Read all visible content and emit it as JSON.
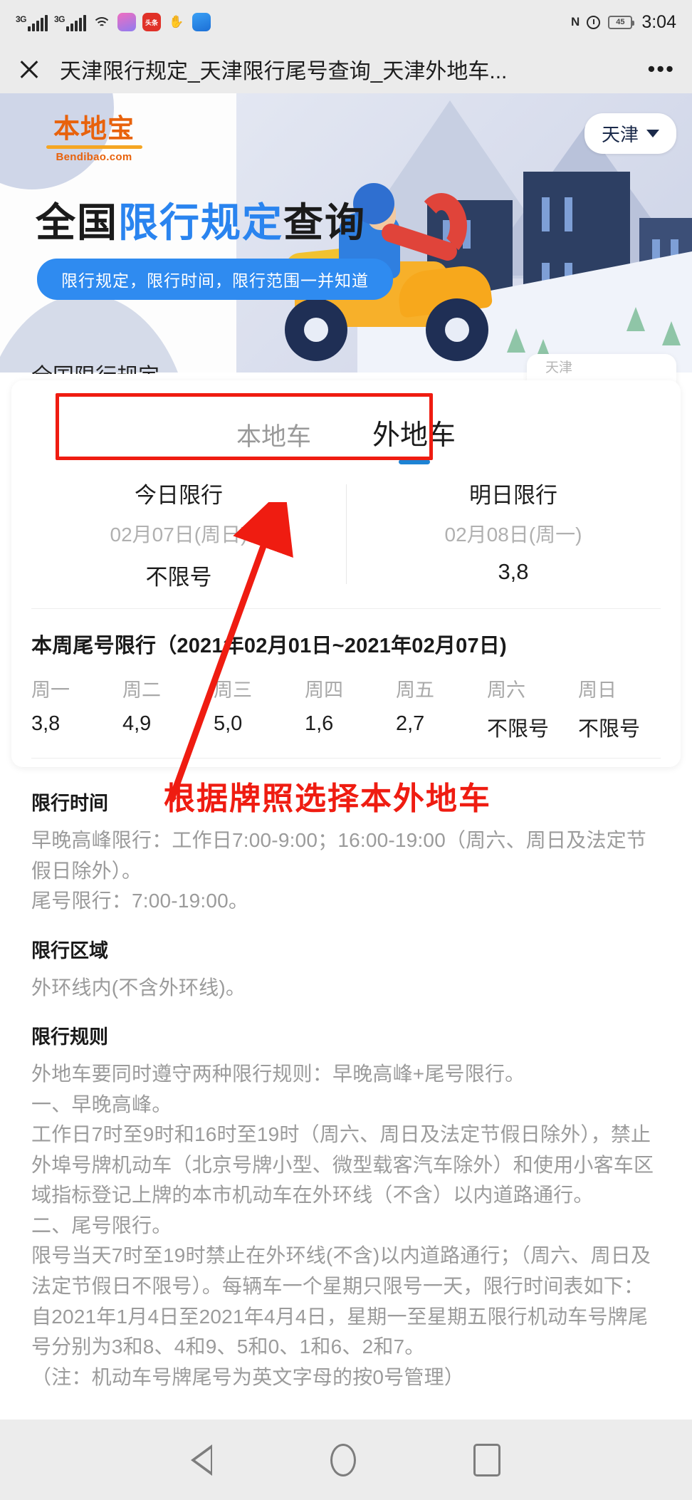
{
  "status_bar": {
    "signal_1": "3G",
    "signal_2": "3G",
    "icons": [
      "signal-icon",
      "signal-icon",
      "wifi-icon",
      "app-icon-pink",
      "app-icon-toutiao",
      "app-icon-hand",
      "app-icon-browser",
      "nfc-icon",
      "alarm-icon"
    ],
    "toutiao_label": "头条",
    "nfc_glyph": "N",
    "battery_level": "45",
    "time": "3:04"
  },
  "title_bar": {
    "title": "天津限行规定_天津限行尾号查询_天津外地车...",
    "close_label": "×",
    "more_label": "•••"
  },
  "banner": {
    "logo_cn": "本地宝",
    "logo_en": "Bendibao.com",
    "title_part1": "全国",
    "title_highlight": "限行规定",
    "title_part2": "查询",
    "subtitle_pill": "限行规定，限行时间，限行范围一并知道",
    "city": "天津",
    "city_caret": "chevron-down-icon",
    "partial_text_behind": "全国限行规定"
  },
  "tabs": [
    {
      "label": "本地车",
      "active": false
    },
    {
      "label": "外地车",
      "active": true
    }
  ],
  "day_cards": [
    {
      "head": "今日限行",
      "date": "02月07日(周日)",
      "value": "不限号"
    },
    {
      "head": "明日限行",
      "date": "02月08日(周一)",
      "value": "3,8"
    }
  ],
  "week": {
    "title": "本周尾号限行（2021年02月01日~2021年02月07日)",
    "headers": [
      "周一",
      "周二",
      "周三",
      "周四",
      "周五",
      "周六",
      "周日"
    ],
    "values": [
      "3,8",
      "4,9",
      "5,0",
      "1,6",
      "2,7",
      "不限号",
      "不限号"
    ]
  },
  "sections": [
    {
      "heading": "限行时间",
      "body": "早晚高峰限行：工作日7:00-9:00；16:00-19:00（周六、周日及法定节假日除外）。\n尾号限行：7:00-19:00。"
    },
    {
      "heading": "限行区域",
      "body": "外环线内(不含外环线)。"
    },
    {
      "heading": "限行规则",
      "body": "外地车要同时遵守两种限行规则：早晚高峰+尾号限行。\n一、早晚高峰。\n工作日7时至9时和16时至19时（周六、周日及法定节假日除外），禁止外埠号牌机动车（北京号牌小型、微型载客汽车除外）和使用小客车区域指标登记上牌的本市机动车在外环线（不含）以内道路通行。\n二、尾号限行。\n限号当天7时至19时禁止在外环线(不含)以内道路通行；（周六、周日及法定节假日不限号）。每辆车一个星期只限号一天，限行时间表如下：\n自2021年1月4日至2021年4月4日，星期一至星期五限行机动车号牌尾号分别为3和8、4和9、5和0、1和6、2和7。\n（注：机动车号牌尾号为英文字母的按0号管理）"
    }
  ],
  "annotations": {
    "label": "根据牌照选择本外地车",
    "color": "#ef1c11",
    "box_target": "外地车 / 本地车 tabs",
    "arrow": "red-arrow-icon"
  },
  "nav_bar": {
    "back": "back-icon",
    "home": "home-icon",
    "recents": "recents-icon"
  }
}
